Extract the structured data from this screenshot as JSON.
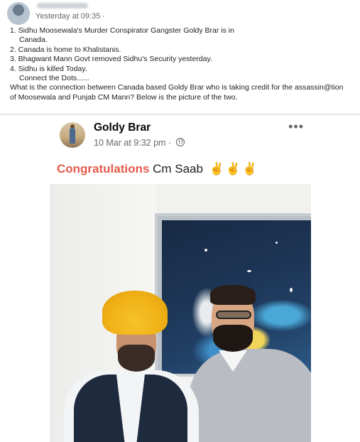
{
  "post": {
    "timestamp": "Yesterday at 09:35",
    "lines": [
      "1. Sidhu Moosewala's Murder Conspirator Gangster Goldy Brar is in",
      "Canada.",
      "2. Canada is home to Khalistanis.",
      "3. Bhagwant Mann Govt removed Sidhu's Security yesterday.",
      "4. Sidhu is killed Today.",
      "Connect the Dots......",
      "What is the connection between Canada based Goldy Brar who is taking credit for the assassin@tion",
      "of Moosewala and Punjab CM Mann? Below is the picture of the two."
    ]
  },
  "shared_post": {
    "author": "Goldy Brar",
    "time": "10 Mar at 9:32 pm",
    "separator": "·",
    "more_glyph": "•••",
    "caption_highlight": "Congratulations",
    "caption_rest": "Cm Saab",
    "caption_emoji": "✌✌✌",
    "icons": {
      "privacy": "globe-icon",
      "more": "more-options-icon"
    }
  },
  "colors": {
    "highlight": "#e35b4a",
    "meta": "#65676b",
    "turban": "#f0b015"
  }
}
